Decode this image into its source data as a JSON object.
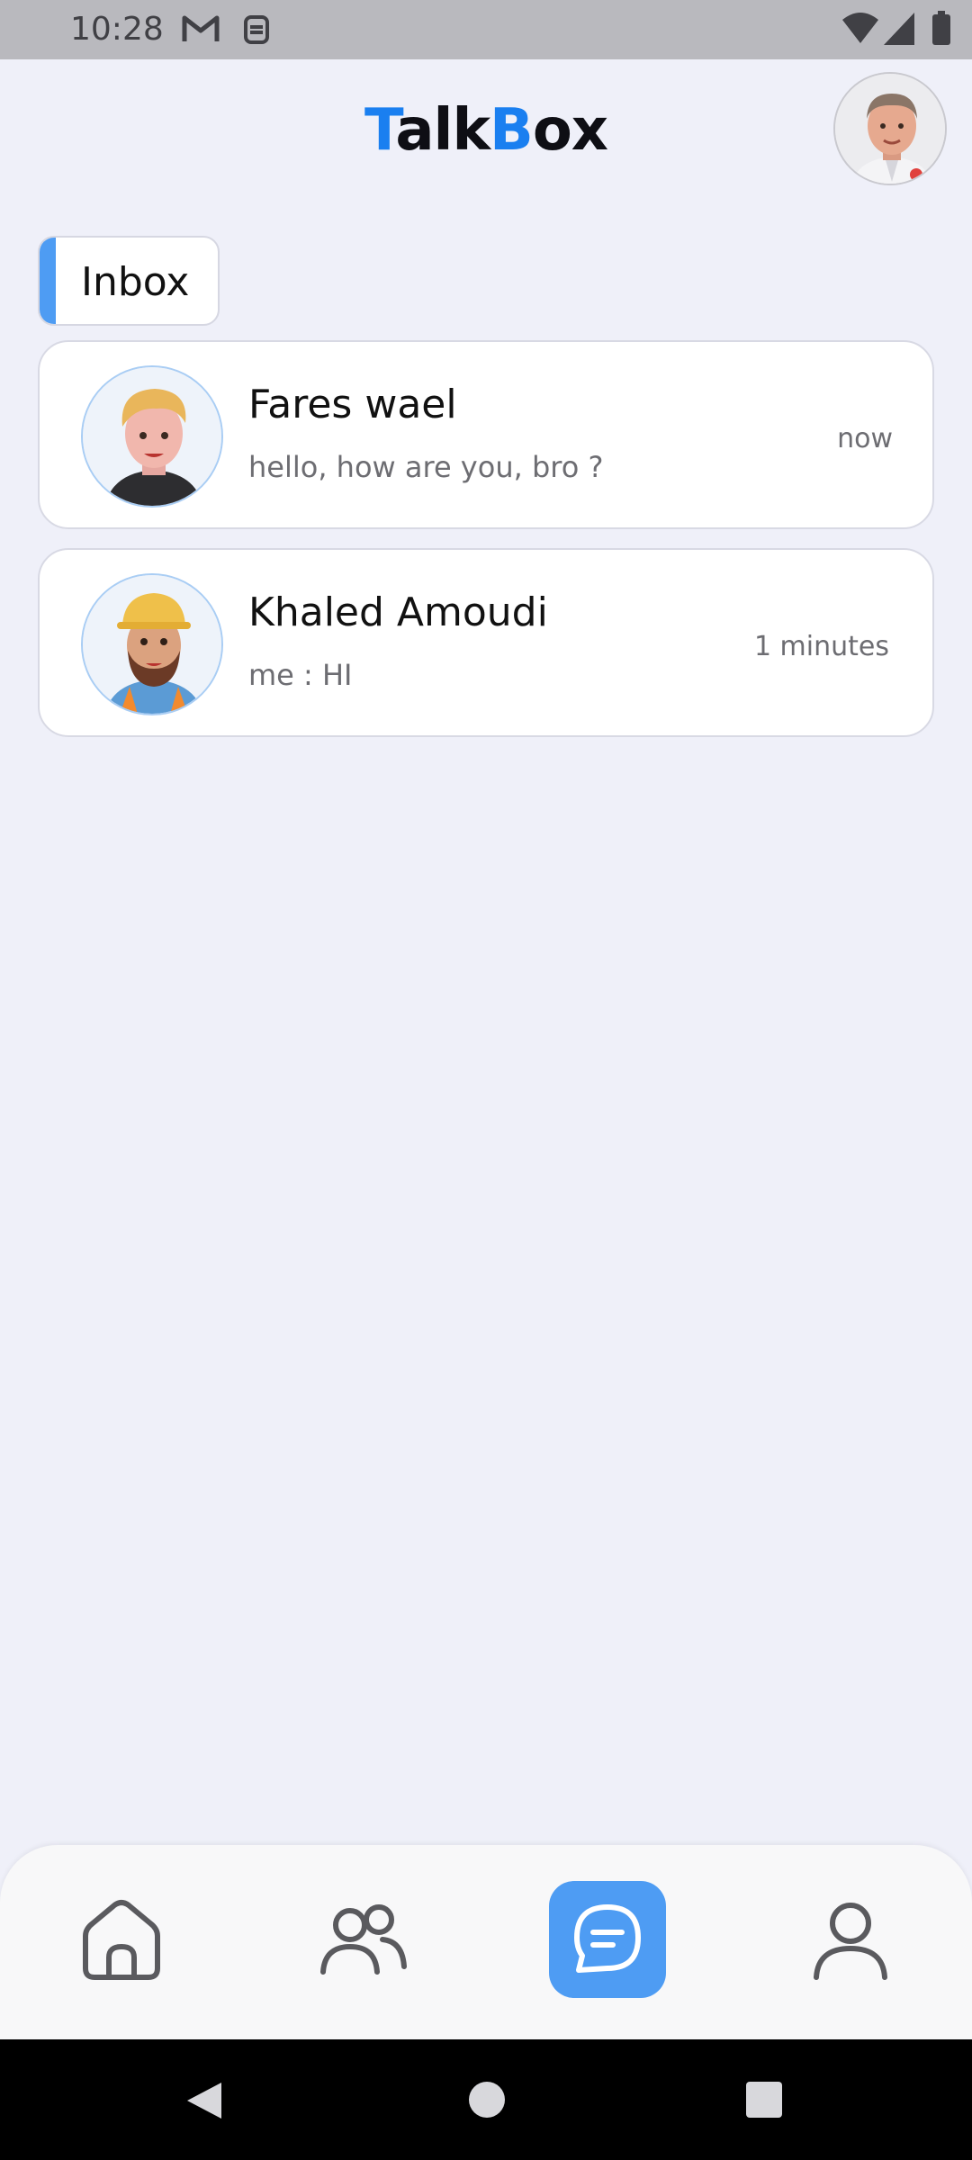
{
  "status_bar": {
    "time": "10:28",
    "icons": [
      "gmail-icon",
      "vpn-icon",
      "wifi-icon",
      "signal-icon",
      "battery-icon"
    ]
  },
  "app": {
    "title_part1_accent": "T",
    "title_part1": "alk",
    "title_part2_accent": "B",
    "title_part2": "ox",
    "accent_color": "#1a7ff0"
  },
  "tabs": {
    "inbox_label": "Inbox"
  },
  "chats": [
    {
      "name": "Fares wael",
      "preview": "hello, how are you, bro ?",
      "time": "now"
    },
    {
      "name": "Khaled Amoudi",
      "preview": "me : HI",
      "time": "1 minutes"
    }
  ],
  "bottom_nav": {
    "items": [
      "home-icon",
      "friends-icon",
      "chat-icon",
      "profile-icon"
    ],
    "active": "chat-icon",
    "active_color": "#4e9cf3"
  }
}
